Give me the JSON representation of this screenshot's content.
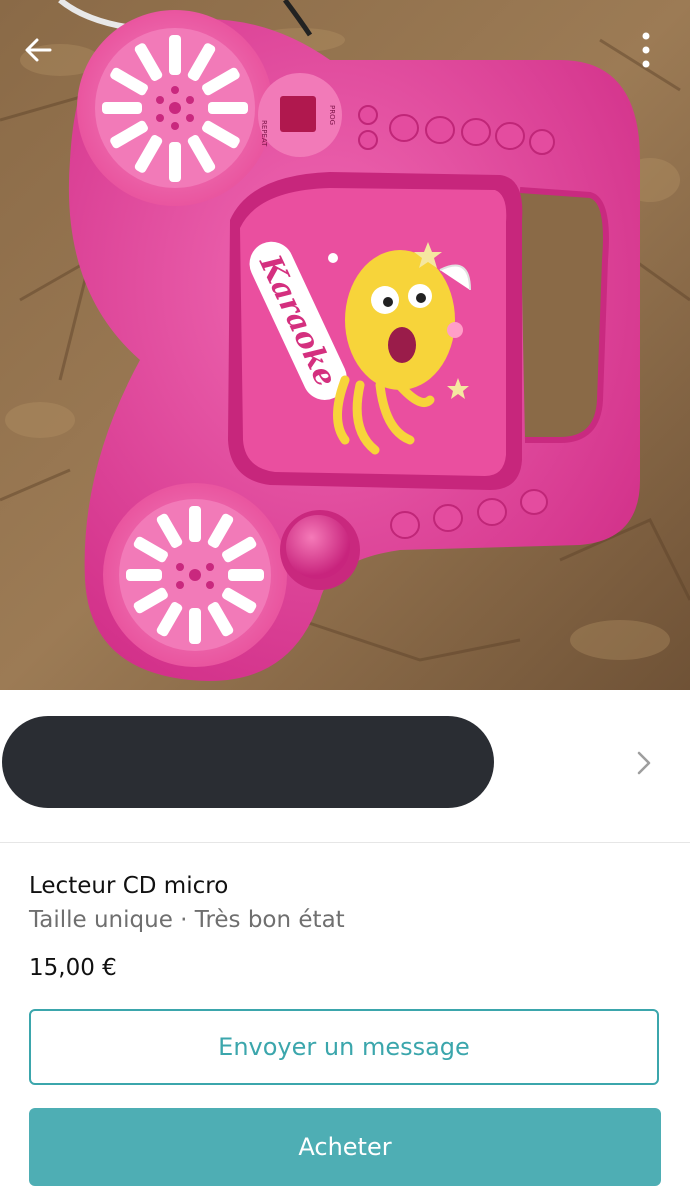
{
  "photo": {
    "toy_text": "Karaoke",
    "display_label_left": "REPEAT",
    "display_label_right": "PROG"
  },
  "nav": {
    "back_icon": "arrow-left-icon",
    "more_icon": "more-vertical-icon"
  },
  "seller": {
    "chevron_icon": "chevron-right-icon"
  },
  "item": {
    "title": "Lecteur CD micro",
    "meta": "Taille unique · Très bon état",
    "price": "15,00 €"
  },
  "actions": {
    "message_label": "Envoyer un message",
    "buy_label": "Acheter"
  },
  "colors": {
    "accent": "#3ba6ac",
    "accent_fill": "#4eaeb4",
    "toy_pink": "#e23f9a"
  }
}
